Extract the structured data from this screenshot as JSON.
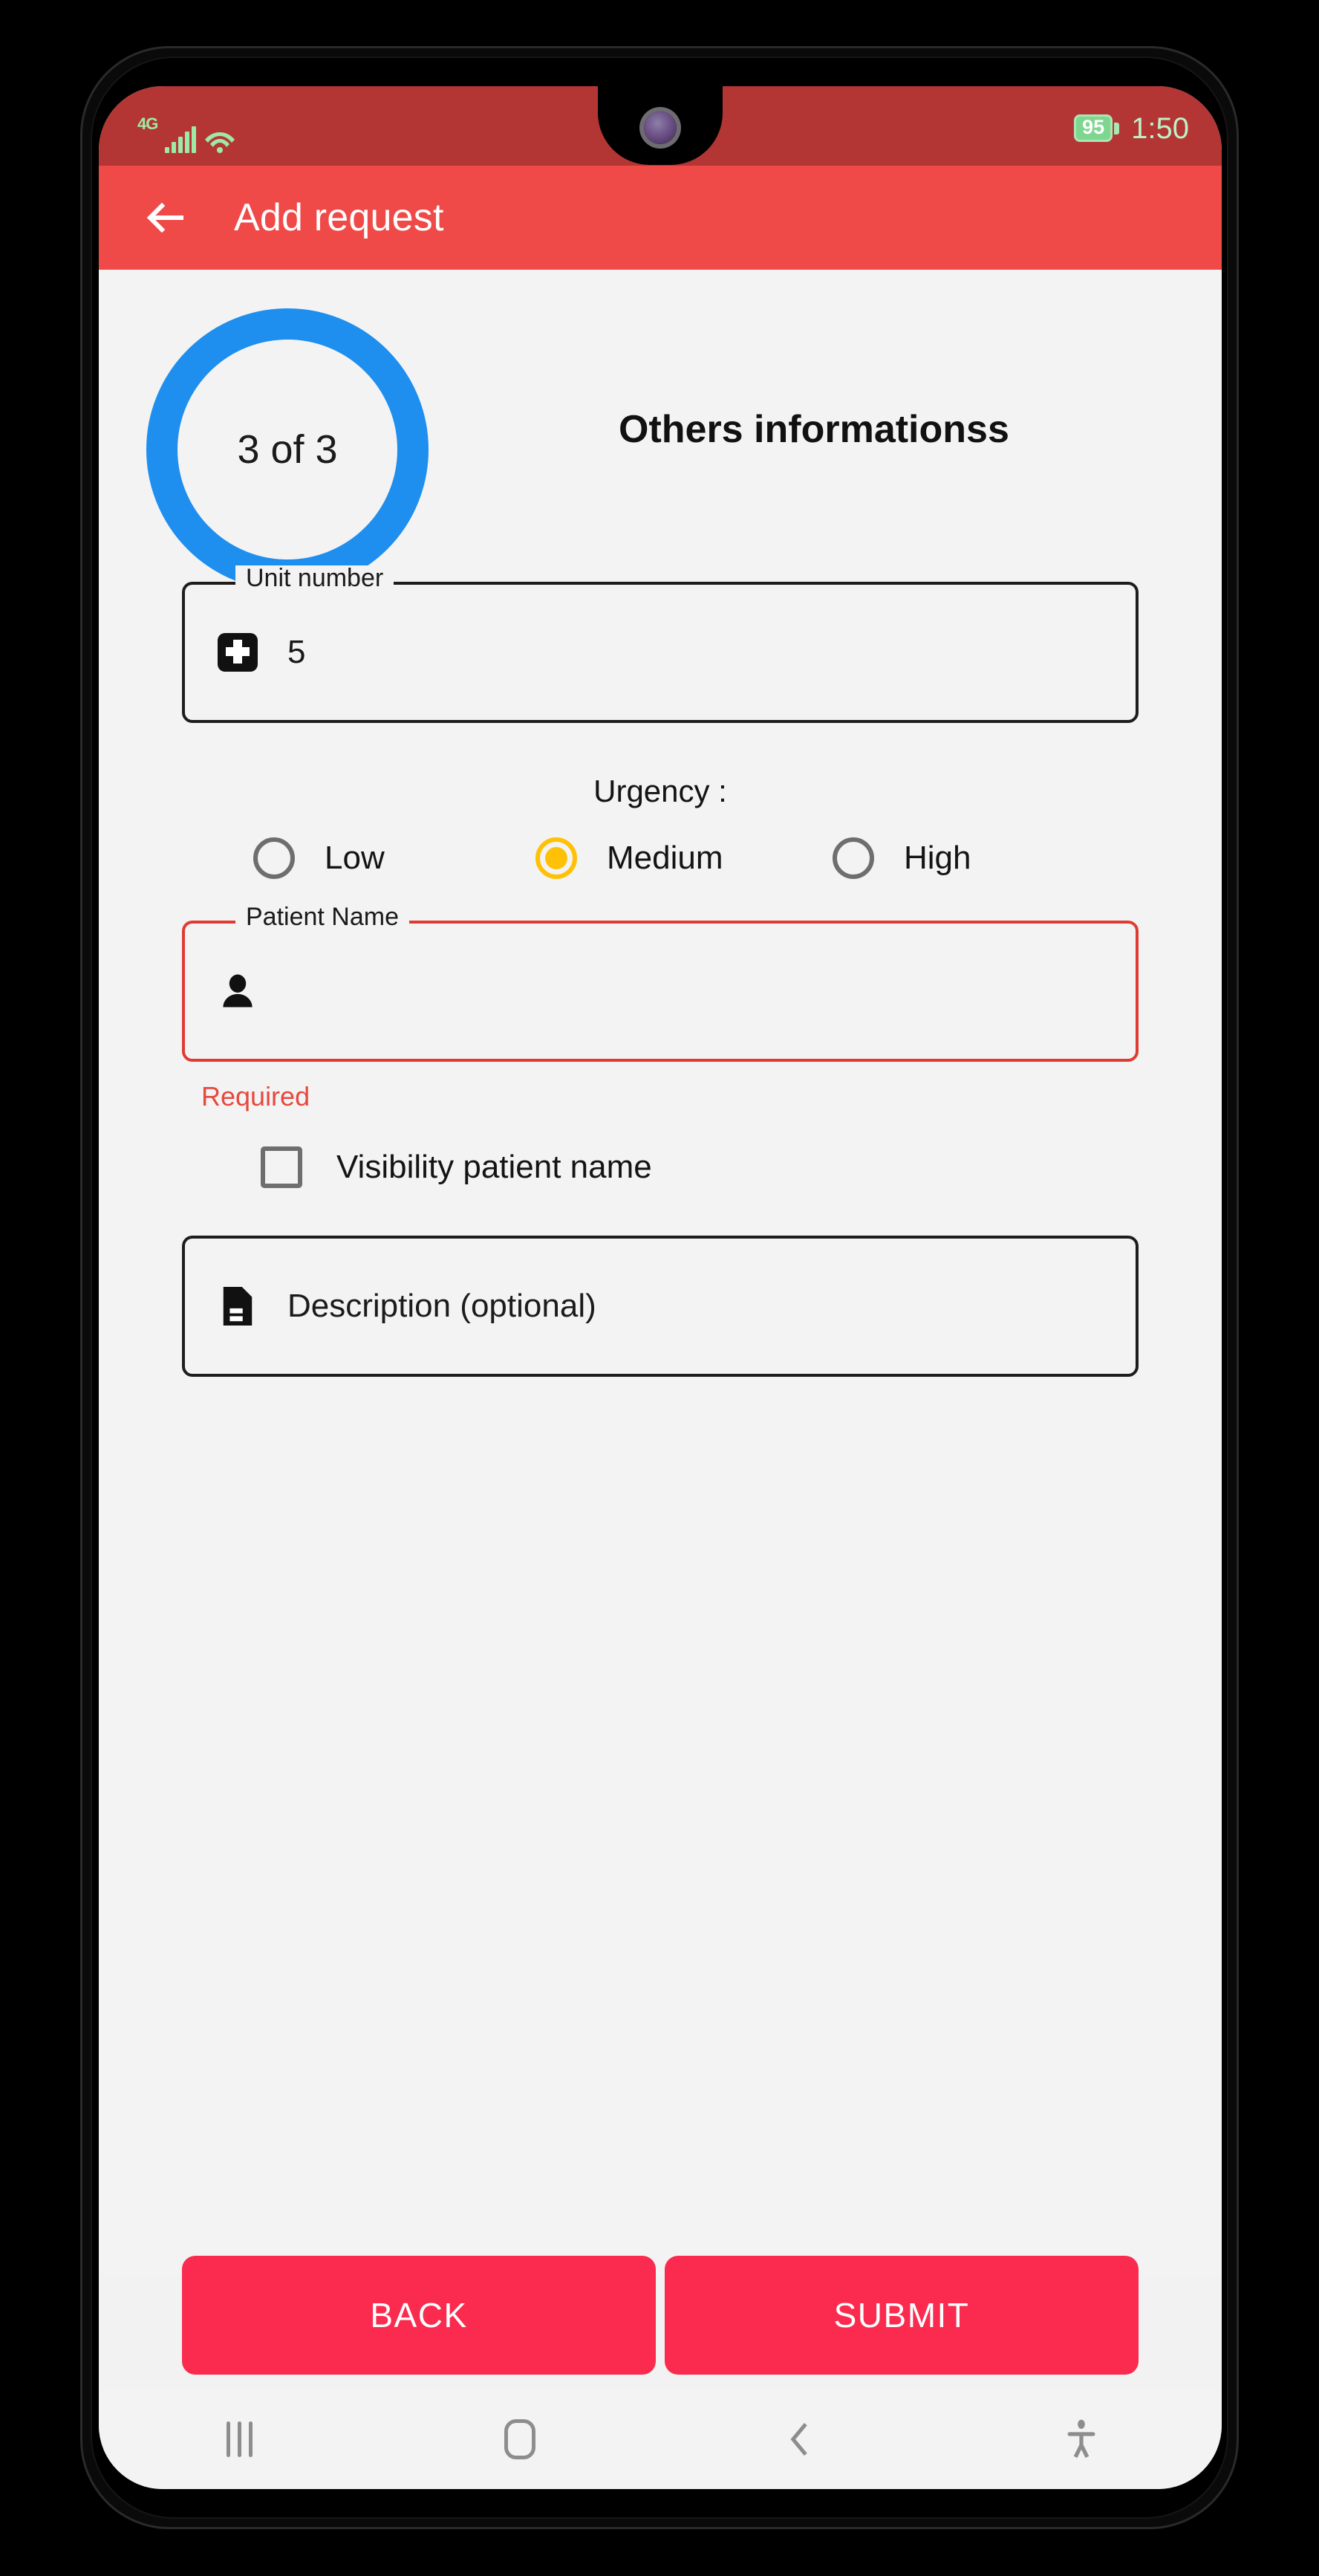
{
  "status_bar": {
    "network_label": "4G",
    "signal_icon": "signal-bars-icon",
    "wifi_icon": "wifi-icon",
    "battery_level": "95",
    "battery_icon": "battery-icon",
    "time": "1:50"
  },
  "app_bar": {
    "back_icon": "back-arrow-icon",
    "title": "Add request"
  },
  "step": {
    "progress_label": "3 of 3",
    "current": 3,
    "total": 3,
    "title": "Others informationss",
    "ring_color": "#1e8eef"
  },
  "form": {
    "unit_number": {
      "label": "Unit number",
      "value": "5",
      "icon": "medical-cross-icon"
    },
    "urgency": {
      "label": "Urgency :",
      "selected": "Medium",
      "selected_color": "#ffc107",
      "options": [
        {
          "label": "Low",
          "selected": false
        },
        {
          "label": "Medium",
          "selected": true
        },
        {
          "label": "High",
          "selected": false
        }
      ]
    },
    "patient_name": {
      "label": "Patient Name",
      "value": "",
      "icon": "person-icon",
      "error": "Required",
      "error_color": "#e8483e"
    },
    "visibility_patient_name": {
      "label": "Visibility patient name",
      "checked": false
    },
    "description": {
      "placeholder": "Description (optional)",
      "value": "",
      "icon": "document-icon"
    }
  },
  "actions": {
    "back_label": "BACK",
    "submit_label": "SUBMIT",
    "button_color": "#fb2b4f"
  },
  "nav_bar": {
    "recents_icon": "recents-icon",
    "home_icon": "home-icon",
    "back_icon": "nav-back-icon",
    "accessibility_icon": "accessibility-icon"
  },
  "theme": {
    "status_bar_color": "#b33634",
    "app_bar_color": "#ef4a48",
    "background_color": "#f3f3f3"
  }
}
